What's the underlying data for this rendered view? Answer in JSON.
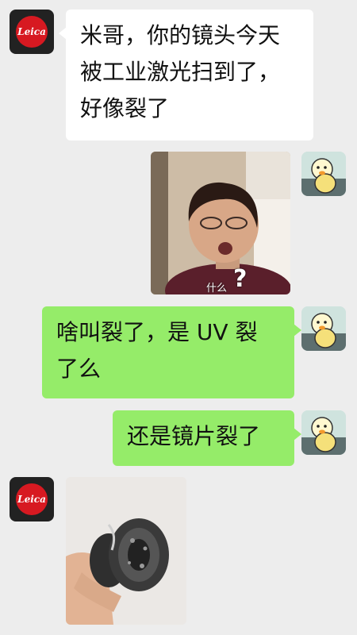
{
  "messages": {
    "m1": {
      "sender": "leica",
      "text": "米哥，你的镜头今天被工业激光扫到了，好像裂了",
      "lines": [
        "米哥，你的镜头今天",
        "被工业激光扫到了，",
        "好像裂了"
      ]
    },
    "m2": {
      "sender": "me",
      "type": "image",
      "caption": "什么",
      "caption_mark": "?"
    },
    "m3": {
      "sender": "me",
      "text": "啥叫裂了，是UV裂了么",
      "lines": [
        "啥叫裂了，是 UV 裂",
        "了么"
      ]
    },
    "m4": {
      "sender": "me",
      "text": "还是镜片裂了"
    },
    "m5": {
      "sender": "leica",
      "type": "image"
    }
  },
  "avatars": {
    "leica_label": "Leica",
    "duck": "duck-avatar"
  },
  "colors": {
    "background": "#ededed",
    "bubble_received": "#ffffff",
    "bubble_sent": "#95ec69",
    "leica_red": "#d71921"
  }
}
